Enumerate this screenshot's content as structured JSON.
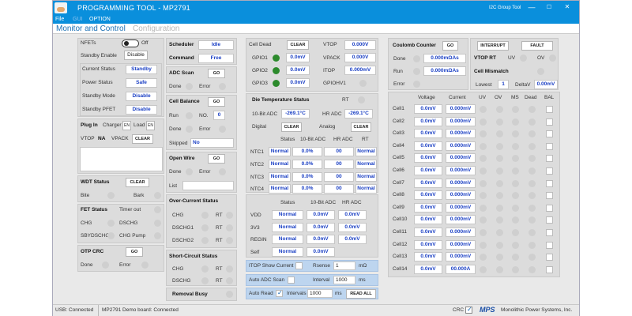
{
  "window": {
    "title": "PROGRAMMING TOOL - MP2791",
    "group": "I2C Group Tool",
    "min": "—",
    "max": "☐",
    "close": "✕"
  },
  "menu": [
    "File",
    "GUI",
    "OPTION"
  ],
  "header": {
    "tab_active": "Monitor and Control",
    "tab_inactive": "Configuration"
  },
  "left": {
    "nfets": "NFETs",
    "nfets_state": "Off",
    "standby_enable": "Standby Enable",
    "standby_enable_btn": "Disable",
    "current_status": "Current Status",
    "current_status_val": "Standby",
    "power_status": "Power Status",
    "power_status_val": "Safe",
    "standby_mode": "Standby Mode",
    "standby_mode_val": "Disable",
    "standby_pfet": "Standby PFET",
    "standby_pfet_val": "Disable",
    "plug_in": "Plug In",
    "charger": "Charger",
    "en1": "EN",
    "load": "Load",
    "en2": "EN",
    "vtop": "VTOP",
    "na": "NA",
    "vpack": "VPACK",
    "clear": "CLEAR",
    "wdt": "WDT Status",
    "wdt_clear": "CLEAR",
    "bite": "Bite",
    "bark": "Bark",
    "fet": "FET Status",
    "timer": "Timer out",
    "chg": "CHG",
    "dschg": "DSCHG",
    "sbydschg": "SBYDSCHG",
    "chgpump": "CHG Pump",
    "otp": "OTP CRC",
    "otp_go": "GO",
    "done": "Done",
    "error": "Error"
  },
  "mid": {
    "scheduler": "Scheduler",
    "scheduler_val": "Idle",
    "command": "Command",
    "command_val": "Free",
    "adc_scan": "ADC Scan",
    "go": "GO",
    "done": "Done",
    "error": "Error",
    "cell_balance": "Cell Balance",
    "run": "Run",
    "no": "NO.",
    "no_val": "0",
    "skipped": "Skipped",
    "skipped_val": "No",
    "open_wire": "Open Wire",
    "list": "List",
    "oc": "Over-Current Status",
    "chg": "CHG",
    "dschg1": "DSCHG1",
    "dschg2": "DSCHG2",
    "rt": "RT",
    "sc": "Short-Circuit Status",
    "dschg": "DSCHG",
    "removal": "Removal Busy"
  },
  "center": {
    "cell_dead": "Cell Dead",
    "clear": "CLEAR",
    "gpio": [
      {
        "name": "GPIO1",
        "val": "0.0mV"
      },
      {
        "name": "GPIO2",
        "val": "0.0mV"
      },
      {
        "name": "GPIO3",
        "val": "0.0mV"
      }
    ],
    "vtop": "VTOP",
    "vtop_val": "0.000V",
    "vpack": "VPACK",
    "vpack_val": "0.000V",
    "itop": "ITOP",
    "itop_val": "0.000mV",
    "gpiohv1": "GPIOHV1",
    "die": "Die Temperature Status",
    "rt": "RT",
    "adc10": "10-Bit ADC",
    "adc10_val": "-269.1°C",
    "hradc": "HR ADC",
    "hradc_val": "-269.1°C",
    "digital": "Digital",
    "analog": "Analog",
    "ntc_headers": [
      "Status",
      "10-Bit ADC",
      "HR ADC",
      "RT"
    ],
    "ntc": [
      {
        "name": "NTC1",
        "status": "Normal",
        "adc": "0.0%",
        "hr": "00",
        "rt": "Normal"
      },
      {
        "name": "NTC2",
        "status": "Normal",
        "adc": "0.0%",
        "hr": "00",
        "rt": "Normal"
      },
      {
        "name": "NTC3",
        "status": "Normal",
        "adc": "0.0%",
        "hr": "00",
        "rt": "Normal"
      },
      {
        "name": "NTC4",
        "status": "Normal",
        "adc": "0.0%",
        "hr": "00",
        "rt": "Normal"
      }
    ],
    "v_headers": [
      "Status",
      "10-Bit ADC",
      "HR ADC"
    ],
    "vrows": [
      {
        "name": "VDD",
        "status": "Normal",
        "adc": "0.0mV",
        "hr": "0.0mV"
      },
      {
        "name": "3V3",
        "status": "Normal",
        "adc": "0.0mV",
        "hr": "0.0mV"
      },
      {
        "name": "REGIN",
        "status": "Normal",
        "adc": "0.0mV",
        "hr": "0.0mV"
      },
      {
        "name": "Self",
        "status": "Normal",
        "adc": "0.0mV",
        "hr": ""
      }
    ],
    "itop_show": "ITOP Show Current",
    "rsense": "Rsense",
    "rsense_val": "1",
    "mohm": "mΩ",
    "auto_adc": "Auto ADC Scan",
    "interval": "Interval",
    "interval_val": "1000",
    "ms": "ms",
    "auto_read": "Auto Read",
    "intervals": "Intervals",
    "intervals_val": "1000",
    "read_all": "READ ALL"
  },
  "right": {
    "cc": "Coulomb Counter",
    "go": "GO",
    "done": "Done",
    "done_val": "0.000mΩAs",
    "run": "Run",
    "run_val": "0.000mΩAs",
    "error": "Error",
    "interrupt": "INTERRUPT",
    "fault": "FAULT",
    "vtop_rt": "VTOP RT",
    "uv": "UV",
    "ov": "OV",
    "mismatch": "Cell Mismatch",
    "lowest": "Lowest",
    "lowest_val": "1",
    "deltav": "DeltaV",
    "deltav_val": "0.00mV",
    "headers": [
      "Voltage",
      "Current",
      "UV",
      "OV",
      "MS",
      "Dead",
      "BAL"
    ],
    "cells": [
      {
        "n": "Cell1",
        "v": "0.0mV",
        "c": "0.000mV"
      },
      {
        "n": "Cell2",
        "v": "0.0mV",
        "c": "0.000mV"
      },
      {
        "n": "Cell3",
        "v": "0.0mV",
        "c": "0.000mV"
      },
      {
        "n": "Cell4",
        "v": "0.0mV",
        "c": "0.000mV"
      },
      {
        "n": "Cell5",
        "v": "0.0mV",
        "c": "0.000mV"
      },
      {
        "n": "Cell6",
        "v": "0.0mV",
        "c": "0.000mV"
      },
      {
        "n": "Cell7",
        "v": "0.0mV",
        "c": "0.000mV"
      },
      {
        "n": "Cell8",
        "v": "0.0mV",
        "c": "0.000mV"
      },
      {
        "n": "Cell9",
        "v": "0.0mV",
        "c": "0.000mV"
      },
      {
        "n": "Cell10",
        "v": "0.0mV",
        "c": "0.000mV"
      },
      {
        "n": "Cell11",
        "v": "0.0mV",
        "c": "0.000mV"
      },
      {
        "n": "Cell12",
        "v": "0.0mV",
        "c": "0.000mV"
      },
      {
        "n": "Cell13",
        "v": "0.0mV",
        "c": "0.000mV"
      },
      {
        "n": "Cell14",
        "v": "0.0mV",
        "c": "00.000A"
      }
    ]
  },
  "status": {
    "usb": "USB: Connected",
    "board": "MP2791 Demo board: Connected",
    "crc": "CRC",
    "brand": "MPS",
    "company": "Monolithic Power Systems, Inc."
  }
}
